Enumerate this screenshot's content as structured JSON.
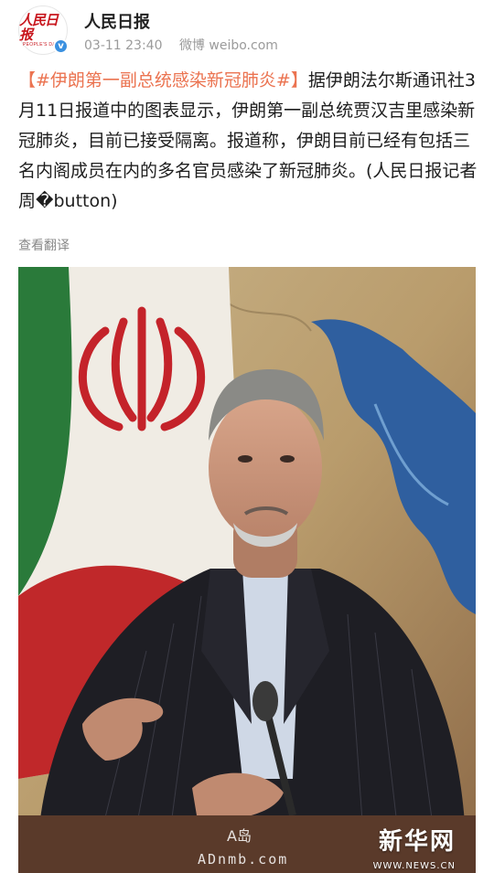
{
  "account": {
    "name": "人民日报",
    "avatar_logo_cn": "人民日报",
    "avatar_logo_en": "PEOPLE'S DAILY",
    "verified_mark": "v"
  },
  "post": {
    "time": "03-11 23:40",
    "source": "微博 weibo.com",
    "bracket_open": "【",
    "hashtag": "#伊朗第一副总统感染新冠肺炎#",
    "bracket_close": "】",
    "body": "据伊朗法尔斯通讯社3月11日报道中的图表显示，伊朗第一副总统贾汉吉里感染新冠肺炎，目前已接受隔离。报道称，伊朗目前已经有包括三名内阁成员在内的多名官员感染了新冠肺炎。(人民日报记者周�button)",
    "translate_label": "查看翻译"
  },
  "image": {
    "watermark_brand": "新华网",
    "watermark_url": "WWW.NEWS.CN",
    "watermark_ad_top": "A岛",
    "watermark_ad": "ADnmb.com"
  },
  "colors": {
    "hashtag": "#eb7350",
    "verified": "#3a90e0",
    "brand_red": "#c8161d"
  }
}
